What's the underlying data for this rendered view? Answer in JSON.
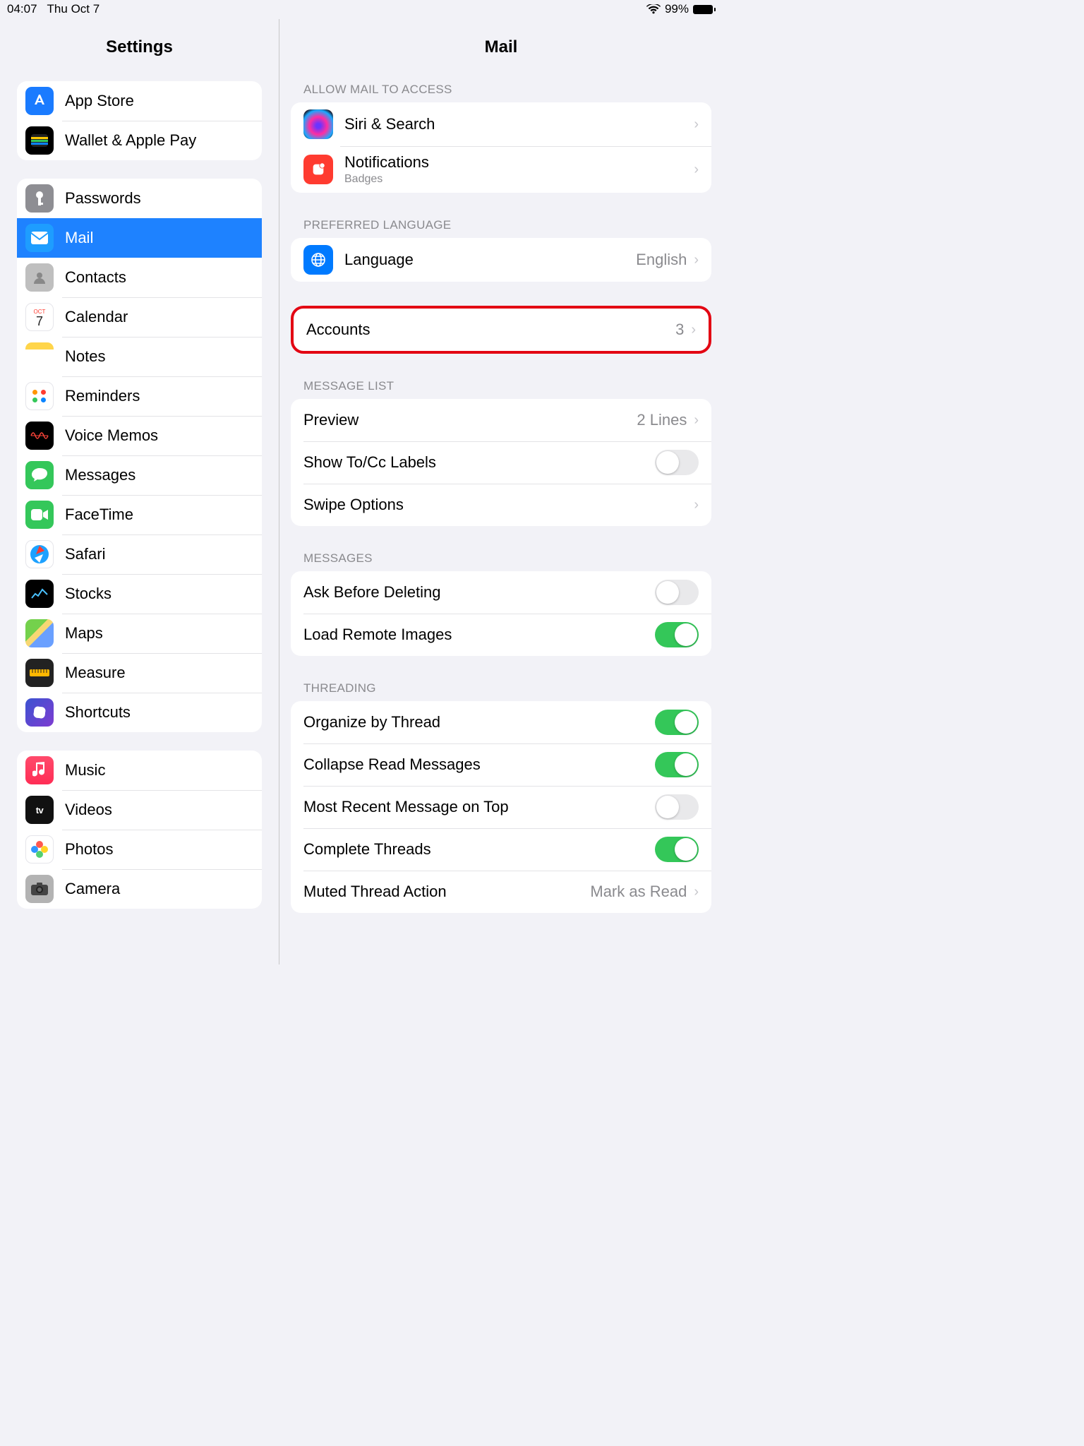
{
  "status": {
    "time": "04:07",
    "date": "Thu Oct 7",
    "battery_pct": "99%"
  },
  "sidebar": {
    "title": "Settings",
    "group_a": [
      {
        "label": "App Store",
        "icon": "appstore"
      },
      {
        "label": "Wallet & Apple Pay",
        "icon": "wallet"
      }
    ],
    "group_b": [
      {
        "label": "Passwords",
        "icon": "pw"
      },
      {
        "label": "Mail",
        "icon": "mail",
        "selected": true
      },
      {
        "label": "Contacts",
        "icon": "contacts"
      },
      {
        "label": "Calendar",
        "icon": "calendar"
      },
      {
        "label": "Notes",
        "icon": "notes"
      },
      {
        "label": "Reminders",
        "icon": "reminders"
      },
      {
        "label": "Voice Memos",
        "icon": "vm"
      },
      {
        "label": "Messages",
        "icon": "msg"
      },
      {
        "label": "FaceTime",
        "icon": "ft"
      },
      {
        "label": "Safari",
        "icon": "safari"
      },
      {
        "label": "Stocks",
        "icon": "stocks"
      },
      {
        "label": "Maps",
        "icon": "maps"
      },
      {
        "label": "Measure",
        "icon": "measure"
      },
      {
        "label": "Shortcuts",
        "icon": "shortcuts"
      }
    ],
    "group_c": [
      {
        "label": "Music",
        "icon": "music"
      },
      {
        "label": "Videos",
        "icon": "videos"
      },
      {
        "label": "Photos",
        "icon": "photos"
      },
      {
        "label": "Camera",
        "icon": "camera"
      }
    ]
  },
  "detail": {
    "title": "Mail",
    "section_access": "ALLOW MAIL TO ACCESS",
    "siri": {
      "label": "Siri & Search"
    },
    "notifications": {
      "label": "Notifications",
      "sub": "Badges"
    },
    "section_lang": "PREFERRED LANGUAGE",
    "language": {
      "label": "Language",
      "value": "English"
    },
    "accounts": {
      "label": "Accounts",
      "value": "3"
    },
    "section_msglist": "MESSAGE LIST",
    "preview": {
      "label": "Preview",
      "value": "2 Lines"
    },
    "show_tocc": {
      "label": "Show To/Cc Labels",
      "on": false
    },
    "swipe": {
      "label": "Swipe Options"
    },
    "section_messages": "MESSAGES",
    "ask_delete": {
      "label": "Ask Before Deleting",
      "on": false
    },
    "load_remote": {
      "label": "Load Remote Images",
      "on": true
    },
    "section_threading": "THREADING",
    "organize": {
      "label": "Organize by Thread",
      "on": true
    },
    "collapse": {
      "label": "Collapse Read Messages",
      "on": true
    },
    "most_recent": {
      "label": "Most Recent Message on Top",
      "on": false
    },
    "complete": {
      "label": "Complete Threads",
      "on": true
    },
    "muted": {
      "label": "Muted Thread Action",
      "value": "Mark as Read"
    }
  }
}
